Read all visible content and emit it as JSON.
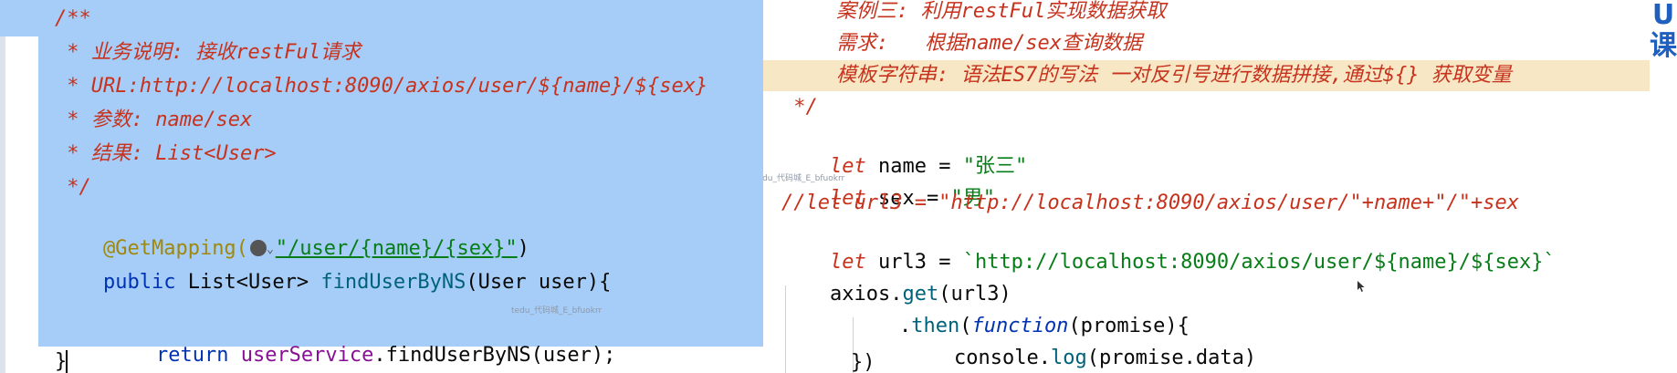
{
  "left_pane": {
    "lines": [
      {
        "text": "/**"
      },
      {
        "text": " * 业务说明: 接收restFul请求"
      },
      {
        "text": " * URL:http://localhost:8090/axios/user/${name}/${sex}"
      },
      {
        "text": " * 参数: name/sex"
      },
      {
        "text": " * 结果: List<User>"
      },
      {
        "text": " */"
      }
    ],
    "annotation": "@GetMapping(",
    "annotation_path": "\"/user/{name}/{sex}\"",
    "annotation_close": ")",
    "method_signature": {
      "kw": "public",
      "ret": " List<User> ",
      "name": "findUserByNS",
      "params": "(User user){"
    },
    "return_line": {
      "kw": "return ",
      "svc": "userService",
      "call": ".findUserByNS(user);"
    },
    "closing": "}",
    "watermark_1": "tedu_代码城_E_bfuokrr",
    "watermark_2": "tedu_代码城_E_bfuokrr"
  },
  "right_pane": {
    "comment_lines": [
      "案例三: 利用restFul实现数据获取",
      "需求:   根据name/sex查询数据",
      "模板字符串: 语法ES7的写法 一对反引号进行数据拼接,通过${} 获取变量"
    ],
    "comment_close": " */",
    "let_name": {
      "kw": "let",
      "rest": " name = ",
      "val": "\"张三\""
    },
    "let_sex": {
      "kw": "let",
      "rest": " sex = ",
      "val": "\"男\""
    },
    "commented_url": "//let url3 = \"http://localhost:8090/axios/user/\"+name+\"/\"+sex",
    "let_url": {
      "kw": "let",
      "rest": " url3 = ",
      "val": "`http://localhost:8090/axios/user/${name}/${sex}`"
    },
    "axios_call": {
      "obj": "axios",
      "dot": ".",
      "fn": "get",
      "args": "(url3)"
    },
    "then_call": {
      "dot": ".",
      "fn": "then",
      "open": "(",
      "kw": "function",
      "args": "(promise){"
    },
    "console_call": {
      "obj": "console",
      "dot": ".",
      "fn": "log",
      "args": "(promise.data)"
    },
    "close_line": "})",
    "side_label": "U\n课"
  },
  "colors": {
    "selection": "#a6cdf7",
    "doc_comment": "#c7321d",
    "keyword": "#0033b3",
    "string": "#067d17",
    "annotation": "#9e880d",
    "highlight_line": "#f7e7c4"
  }
}
